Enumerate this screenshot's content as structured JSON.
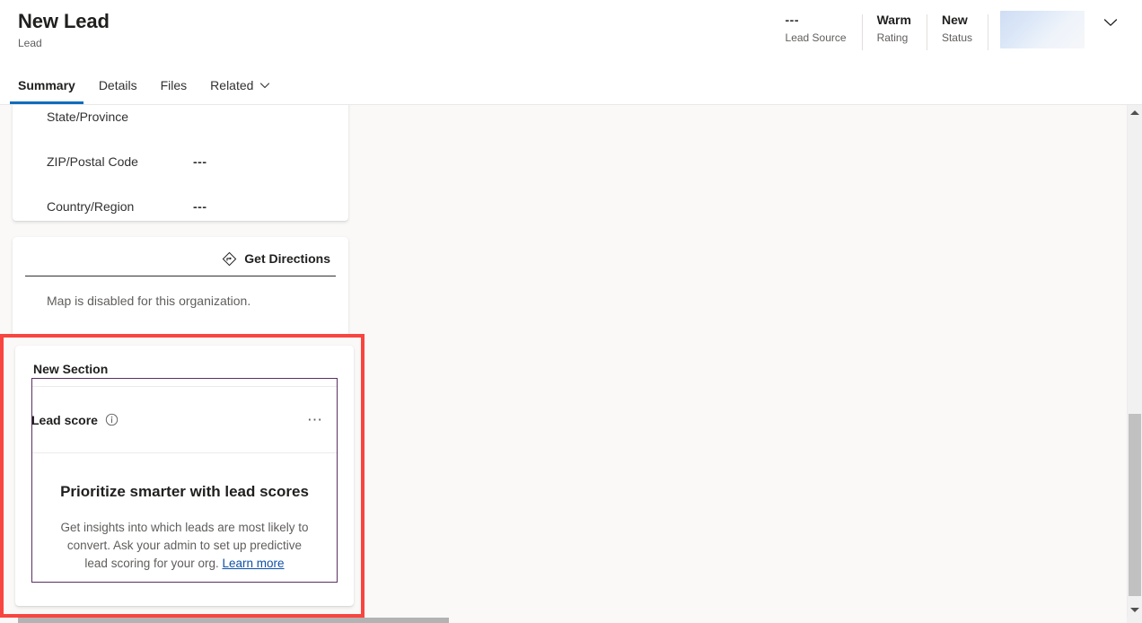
{
  "header": {
    "title": "New Lead",
    "subtitle": "Lead",
    "fields": [
      {
        "value": "---",
        "label": "Lead Source"
      },
      {
        "value": "Warm",
        "label": "Rating"
      },
      {
        "value": "New",
        "label": "Status"
      }
    ],
    "placeholder_icon": "loading-shimmer-placeholder",
    "chevron_icon": "chevron-down-icon",
    "accent_color": "#0f6cbd"
  },
  "tabs": [
    {
      "label": "Summary",
      "active": true
    },
    {
      "label": "Details",
      "active": false
    },
    {
      "label": "Files",
      "active": false
    },
    {
      "label": "Related",
      "active": false,
      "chevron": "chevron-down-icon"
    }
  ],
  "address_card": {
    "rows": [
      {
        "label": "State/Province",
        "value": ""
      },
      {
        "label": "ZIP/Postal Code",
        "value": "---"
      },
      {
        "label": "Country/Region",
        "value": "---"
      }
    ]
  },
  "map_card": {
    "directions_label": "Get Directions",
    "directions_icon": "get-directions-icon",
    "disabled_message": "Map is disabled for this organization."
  },
  "lead_score_section": {
    "section_title": "New Section",
    "control_title": "Lead score",
    "info_icon": "info-icon",
    "more_icon": "more-options-icon",
    "heading": "Prioritize smarter with lead scores",
    "description": "Get insights into which leads are most likely to convert. Ask your admin to set up predictive lead scoring for your org.",
    "link_label": "Learn more",
    "highlight_color": "#f8453f",
    "control_border_color": "#5c2e63"
  },
  "scrollbars": {
    "vertical_up_icon": "scroll-up-arrow-icon",
    "vertical_down_icon": "scroll-down-arrow-icon"
  }
}
